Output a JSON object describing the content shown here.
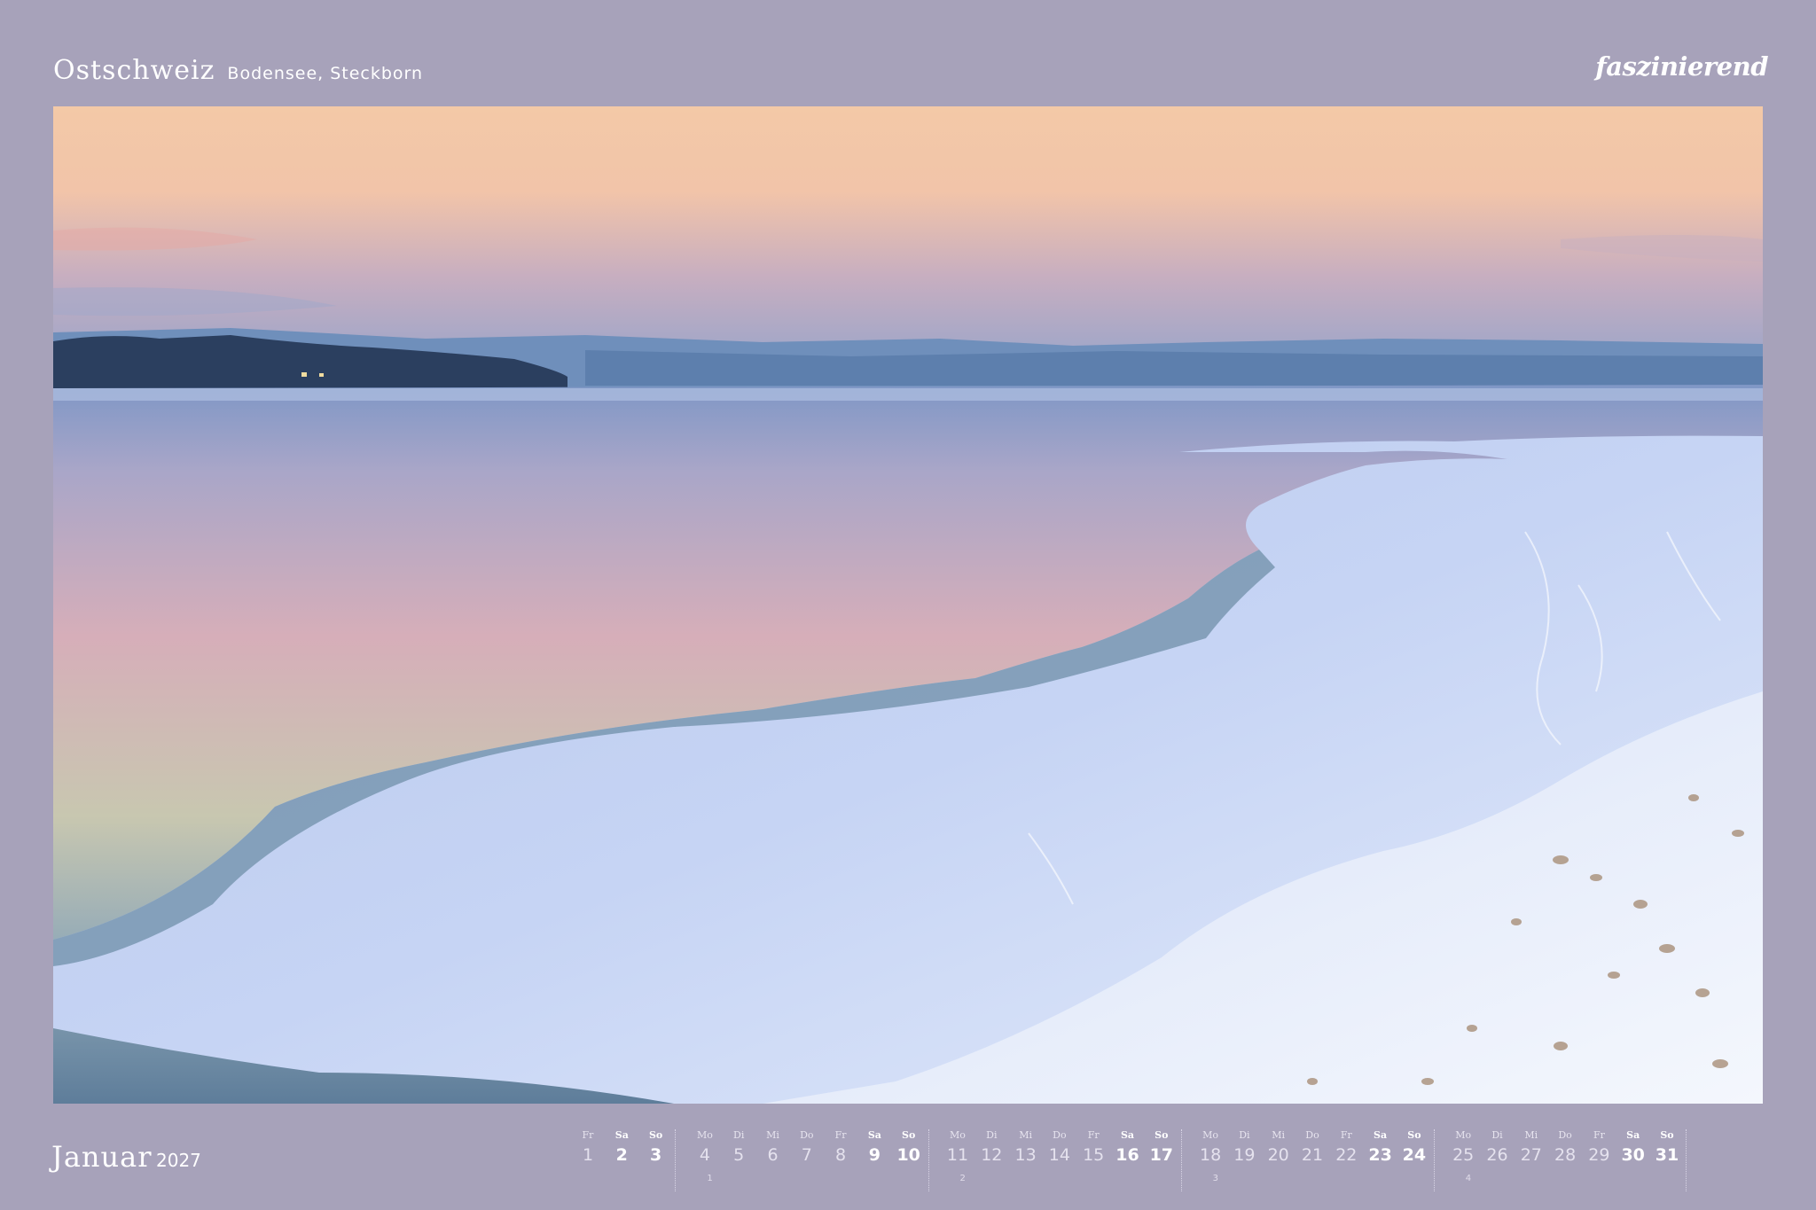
{
  "header": {
    "region": "Ostschweiz",
    "location": "Bodensee, Steckborn",
    "brand": "faszinierend"
  },
  "footer": {
    "month": "Januar",
    "year": "2027"
  },
  "calendar": {
    "days": [
      {
        "dow": "Fr",
        "num": "1",
        "weekend": false
      },
      {
        "dow": "Sa",
        "num": "2",
        "weekend": true
      },
      {
        "dow": "So",
        "num": "3",
        "weekend": true
      },
      {
        "dow": "Mo",
        "num": "4",
        "weekend": false
      },
      {
        "dow": "Di",
        "num": "5",
        "weekend": false
      },
      {
        "dow": "Mi",
        "num": "6",
        "weekend": false
      },
      {
        "dow": "Do",
        "num": "7",
        "weekend": false
      },
      {
        "dow": "Fr",
        "num": "8",
        "weekend": false
      },
      {
        "dow": "Sa",
        "num": "9",
        "weekend": true
      },
      {
        "dow": "So",
        "num": "10",
        "weekend": true
      },
      {
        "dow": "Mo",
        "num": "11",
        "weekend": false
      },
      {
        "dow": "Di",
        "num": "12",
        "weekend": false
      },
      {
        "dow": "Mi",
        "num": "13",
        "weekend": false
      },
      {
        "dow": "Do",
        "num": "14",
        "weekend": false
      },
      {
        "dow": "Fr",
        "num": "15",
        "weekend": false
      },
      {
        "dow": "Sa",
        "num": "16",
        "weekend": true
      },
      {
        "dow": "So",
        "num": "17",
        "weekend": true
      },
      {
        "dow": "Mo",
        "num": "18",
        "weekend": false
      },
      {
        "dow": "Di",
        "num": "19",
        "weekend": false
      },
      {
        "dow": "Mi",
        "num": "20",
        "weekend": false
      },
      {
        "dow": "Do",
        "num": "21",
        "weekend": false
      },
      {
        "dow": "Fr",
        "num": "22",
        "weekend": false
      },
      {
        "dow": "Sa",
        "num": "23",
        "weekend": true
      },
      {
        "dow": "So",
        "num": "24",
        "weekend": true
      },
      {
        "dow": "Mo",
        "num": "25",
        "weekend": false
      },
      {
        "dow": "Di",
        "num": "26",
        "weekend": false
      },
      {
        "dow": "Mi",
        "num": "27",
        "weekend": false
      },
      {
        "dow": "Do",
        "num": "28",
        "weekend": false
      },
      {
        "dow": "Fr",
        "num": "29",
        "weekend": false
      },
      {
        "dow": "Sa",
        "num": "30",
        "weekend": true
      },
      {
        "dow": "So",
        "num": "31",
        "weekend": true
      }
    ],
    "weeks": [
      "1",
      "2",
      "3",
      "4"
    ]
  },
  "colors": {
    "background": "#a7a2ba",
    "text": "#ffffff"
  }
}
